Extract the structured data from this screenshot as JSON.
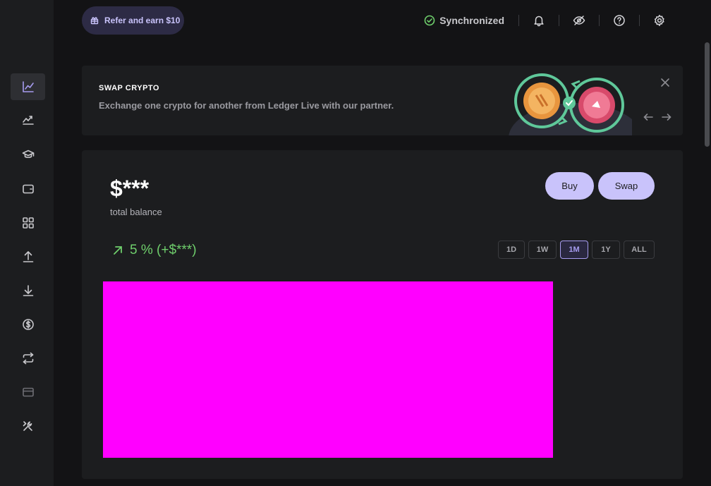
{
  "sidebar": {
    "items": [
      {
        "name": "portfolio",
        "icon": "portfolio-icon",
        "active": true
      },
      {
        "name": "market",
        "icon": "market-icon"
      },
      {
        "name": "learn",
        "icon": "learn-icon"
      },
      {
        "name": "accounts",
        "icon": "wallet-icon"
      },
      {
        "name": "discover",
        "icon": "grid-icon"
      },
      {
        "name": "send",
        "icon": "upload-icon"
      },
      {
        "name": "receive",
        "icon": "download-icon"
      },
      {
        "name": "earn",
        "icon": "dollar-icon"
      },
      {
        "name": "swap",
        "icon": "swap-icon"
      },
      {
        "name": "card",
        "icon": "card-icon",
        "dim": true
      },
      {
        "name": "manager",
        "icon": "tools-icon"
      }
    ]
  },
  "topbar": {
    "refer_label": "Refer and earn $10",
    "sync_label": "Synchronized",
    "sync_color": "#6fcf6c"
  },
  "banner": {
    "title": "SWAP CRYPTO",
    "description": "Exchange one crypto for another from Ledger Live with our partner."
  },
  "portfolio": {
    "balance": "$***",
    "balance_label": "total balance",
    "buy_label": "Buy",
    "swap_label": "Swap",
    "change_text": "5 % (+$***)",
    "ranges": [
      "1D",
      "1W",
      "1M",
      "1Y",
      "ALL"
    ],
    "selected_range": "1M"
  },
  "colors": {
    "accent": "#c9c3fb",
    "positive": "#6fcf6c",
    "chart_placeholder": "#ff00ff"
  }
}
